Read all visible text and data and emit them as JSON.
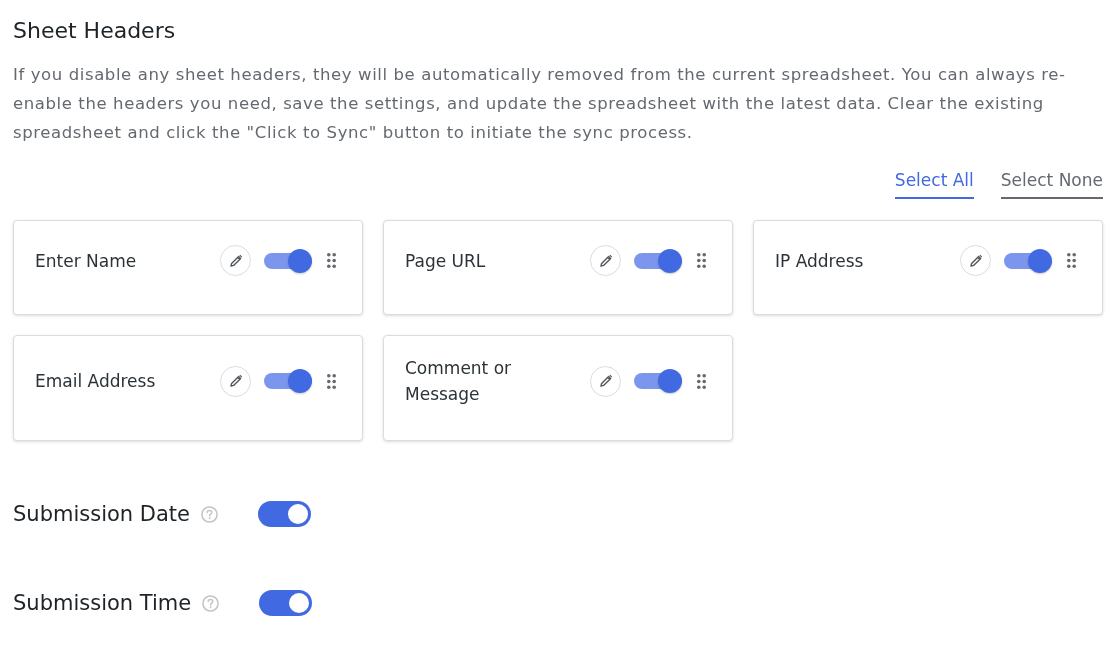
{
  "title": "Sheet Headers",
  "description": "If you disable any sheet headers, they will be automatically removed from the current spreadsheet. You can always re-enable the headers you need, save the settings, and update the spreadsheet with the latest data. Clear the existing spreadsheet and click the \"Click to Sync\" button to initiate the sync process.",
  "bulk_actions": [
    {
      "label": "Select All",
      "selected": true
    },
    {
      "label": "Select None",
      "selected": false
    }
  ],
  "header_cards": [
    {
      "label": "Enter Name",
      "on": true
    },
    {
      "label": "Page URL",
      "on": true
    },
    {
      "label": "IP Address",
      "on": true
    },
    {
      "label": "Email Address",
      "on": true
    },
    {
      "label": "Comment or Message",
      "on": true
    }
  ],
  "settings": [
    {
      "label": "Submission Date",
      "on": true
    },
    {
      "label": "Submission Time",
      "on": true
    }
  ]
}
